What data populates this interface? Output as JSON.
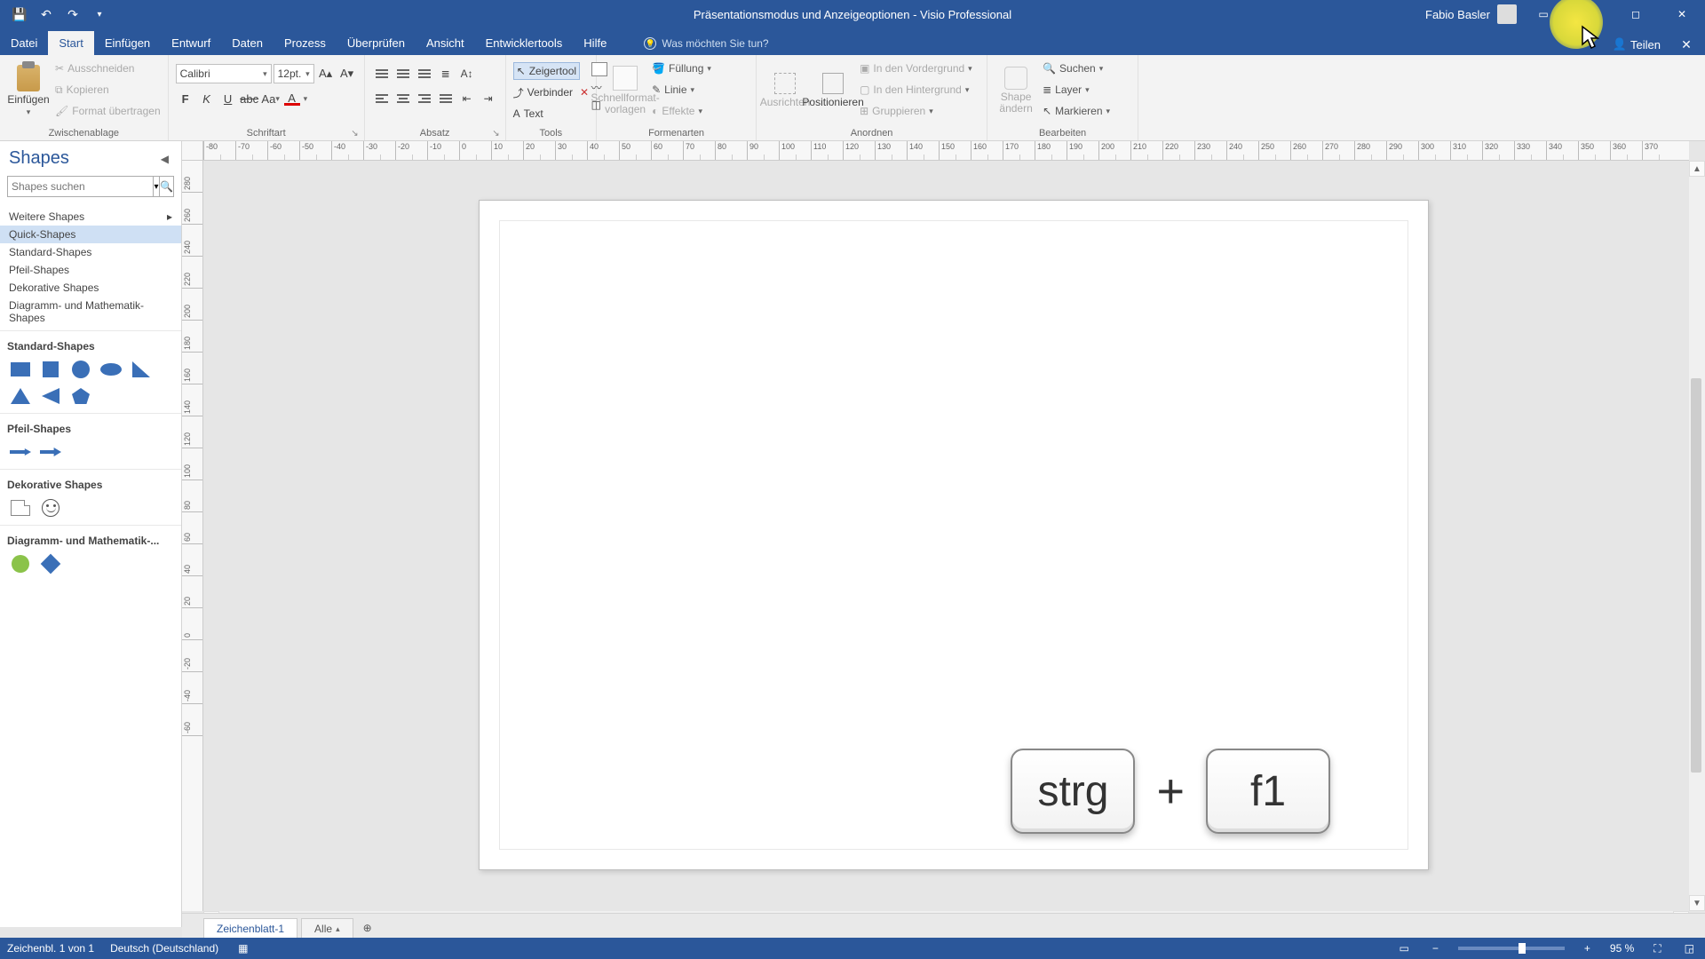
{
  "title": "Präsentationsmodus und Anzeigeoptionen  -  Visio Professional",
  "user": "Fabio Basler",
  "tabs": [
    "Datei",
    "Start",
    "Einfügen",
    "Entwurf",
    "Daten",
    "Prozess",
    "Überprüfen",
    "Ansicht",
    "Entwicklertools",
    "Hilfe"
  ],
  "active_tab": 1,
  "tell_me": "Was möchten Sie tun?",
  "share": "Teilen",
  "ribbon": {
    "clipboard": {
      "label": "Zwischenablage",
      "paste": "Einfügen",
      "cut": "Ausschneiden",
      "copy": "Kopieren",
      "format_painter": "Format übertragen"
    },
    "font": {
      "label": "Schriftart",
      "name": "Calibri",
      "size": "12pt."
    },
    "paragraph": {
      "label": "Absatz"
    },
    "tools": {
      "label": "Tools",
      "pointer": "Zeigertool",
      "connector": "Verbinder",
      "text": "Text"
    },
    "shape_styles": {
      "label": "Formenarten",
      "templates": "Schnellformat-vorlagen",
      "fill": "Füllung",
      "line": "Linie",
      "effects": "Effekte"
    },
    "arrange": {
      "label": "Anordnen",
      "align": "Ausrichten",
      "position": "Positionieren",
      "front": "In den Vordergrund",
      "back": "In den Hintergrund",
      "group": "Gruppieren"
    },
    "editing": {
      "label": "Bearbeiten",
      "change_shape": "Shape ändern",
      "find": "Suchen",
      "layer": "Layer",
      "select": "Markieren"
    }
  },
  "shapes_pane": {
    "title": "Shapes",
    "search_placeholder": "Shapes suchen",
    "more": "Weitere Shapes",
    "categories": [
      "Quick-Shapes",
      "Standard-Shapes",
      "Pfeil-Shapes",
      "Dekorative Shapes",
      "Diagramm- und Mathematik-Shapes"
    ],
    "selected_category": 0,
    "sections": {
      "standard": "Standard-Shapes",
      "arrows": "Pfeil-Shapes",
      "decorative": "Dekorative Shapes",
      "diagram": "Diagramm- und Mathematik-..."
    }
  },
  "ruler_h": [
    "-80",
    "-70",
    "-60",
    "-50",
    "-40",
    "-30",
    "-20",
    "-10",
    "0",
    "10",
    "20",
    "30",
    "40",
    "50",
    "60",
    "70",
    "80",
    "90",
    "100",
    "110",
    "120",
    "130",
    "140",
    "150",
    "160",
    "170",
    "180",
    "190",
    "200",
    "210",
    "220",
    "230",
    "240",
    "250",
    "260",
    "270",
    "280",
    "290",
    "300",
    "310",
    "320",
    "330",
    "340",
    "350",
    "360",
    "370"
  ],
  "ruler_v": [
    "280",
    "260",
    "240",
    "220",
    "200",
    "180",
    "160",
    "140",
    "120",
    "100",
    "80",
    "60",
    "40",
    "20",
    "0",
    "-20",
    "-40",
    "-60"
  ],
  "page_tabs": {
    "page1": "Zeichenblatt-1",
    "all": "Alle"
  },
  "status": {
    "page_info": "Zeichenbl. 1 von 1",
    "lang": "Deutsch (Deutschland)",
    "zoom": "95 %"
  },
  "overlay": {
    "key1": "strg",
    "plus": "+",
    "key2": "f1"
  }
}
